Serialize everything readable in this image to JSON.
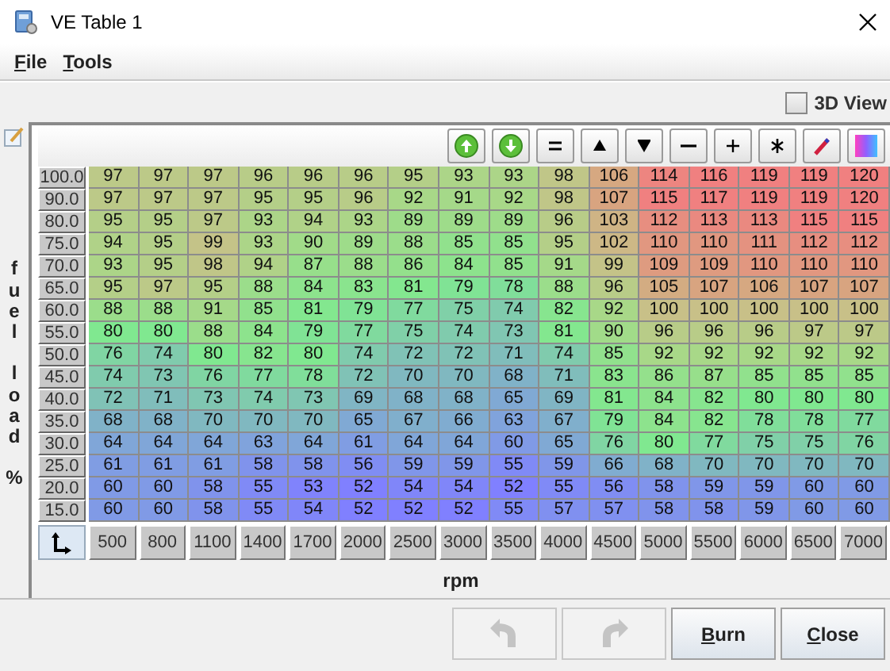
{
  "window": {
    "title": "VE Table 1"
  },
  "menu": [
    {
      "label": "File"
    },
    {
      "label": "Tools"
    }
  ],
  "view_3d": {
    "label": "3D View",
    "checked": false
  },
  "table": {
    "y_axis_label": "fuel load %",
    "x_axis_label": "rpm",
    "rpm": [
      "500",
      "800",
      "1100",
      "1400",
      "1700",
      "2000",
      "2500",
      "3000",
      "3500",
      "4000",
      "4500",
      "5000",
      "5500",
      "6000",
      "6500",
      "7000"
    ],
    "rows": [
      {
        "load": "100.0",
        "cells": [
          "97",
          "97",
          "97",
          "96",
          "96",
          "96",
          "95",
          "93",
          "93",
          "98",
          "106",
          "114",
          "116",
          "119",
          "119",
          "120"
        ]
      },
      {
        "load": "90.0",
        "cells": [
          "97",
          "97",
          "97",
          "95",
          "95",
          "96",
          "92",
          "91",
          "92",
          "98",
          "107",
          "115",
          "117",
          "119",
          "119",
          "120"
        ]
      },
      {
        "load": "80.0",
        "cells": [
          "95",
          "95",
          "97",
          "93",
          "94",
          "93",
          "89",
          "89",
          "89",
          "96",
          "103",
          "112",
          "113",
          "113",
          "115",
          "115"
        ]
      },
      {
        "load": "75.0",
        "cells": [
          "94",
          "95",
          "99",
          "93",
          "90",
          "89",
          "88",
          "85",
          "85",
          "95",
          "102",
          "110",
          "110",
          "111",
          "112",
          "112"
        ]
      },
      {
        "load": "70.0",
        "cells": [
          "93",
          "95",
          "98",
          "94",
          "87",
          "88",
          "86",
          "84",
          "85",
          "91",
          "99",
          "109",
          "109",
          "110",
          "110",
          "110"
        ]
      },
      {
        "load": "65.0",
        "cells": [
          "95",
          "97",
          "95",
          "88",
          "84",
          "83",
          "81",
          "79",
          "78",
          "88",
          "96",
          "105",
          "107",
          "106",
          "107",
          "107"
        ]
      },
      {
        "load": "60.0",
        "cells": [
          "88",
          "88",
          "91",
          "85",
          "81",
          "79",
          "77",
          "75",
          "74",
          "82",
          "92",
          "100",
          "100",
          "100",
          "100",
          "100"
        ]
      },
      {
        "load": "55.0",
        "cells": [
          "80",
          "80",
          "88",
          "84",
          "79",
          "77",
          "75",
          "74",
          "73",
          "81",
          "90",
          "96",
          "96",
          "96",
          "97",
          "97"
        ]
      },
      {
        "load": "50.0",
        "cells": [
          "76",
          "74",
          "80",
          "82",
          "80",
          "74",
          "72",
          "72",
          "71",
          "74",
          "85",
          "92",
          "92",
          "92",
          "92",
          "92"
        ]
      },
      {
        "load": "45.0",
        "cells": [
          "74",
          "73",
          "76",
          "77",
          "78",
          "72",
          "70",
          "70",
          "68",
          "71",
          "83",
          "86",
          "87",
          "85",
          "85",
          "85"
        ]
      },
      {
        "load": "40.0",
        "cells": [
          "72",
          "71",
          "73",
          "74",
          "73",
          "69",
          "68",
          "68",
          "65",
          "69",
          "81",
          "84",
          "82",
          "80",
          "80",
          "80"
        ]
      },
      {
        "load": "35.0",
        "cells": [
          "68",
          "68",
          "70",
          "70",
          "70",
          "65",
          "67",
          "66",
          "63",
          "67",
          "79",
          "84",
          "82",
          "78",
          "78",
          "77"
        ]
      },
      {
        "load": "30.0",
        "cells": [
          "64",
          "64",
          "64",
          "63",
          "64",
          "61",
          "64",
          "64",
          "60",
          "65",
          "76",
          "80",
          "77",
          "75",
          "75",
          "76"
        ]
      },
      {
        "load": "25.0",
        "cells": [
          "61",
          "61",
          "61",
          "58",
          "58",
          "56",
          "59",
          "59",
          "55",
          "59",
          "66",
          "68",
          "70",
          "70",
          "70",
          "70"
        ]
      },
      {
        "load": "20.0",
        "cells": [
          "60",
          "60",
          "58",
          "55",
          "53",
          "52",
          "54",
          "54",
          "52",
          "55",
          "56",
          "58",
          "59",
          "59",
          "60",
          "60"
        ]
      },
      {
        "load": "15.0",
        "cells": [
          "60",
          "60",
          "58",
          "55",
          "54",
          "52",
          "52",
          "52",
          "55",
          "57",
          "57",
          "58",
          "58",
          "59",
          "60",
          "60"
        ]
      }
    ]
  },
  "buttons": [
    {
      "kind": "undo",
      "disabled": true
    },
    {
      "kind": "redo",
      "disabled": true
    },
    {
      "kind": "text",
      "label": "Burn",
      "disabled": false
    },
    {
      "kind": "text",
      "label": "Close",
      "disabled": false
    }
  ]
}
